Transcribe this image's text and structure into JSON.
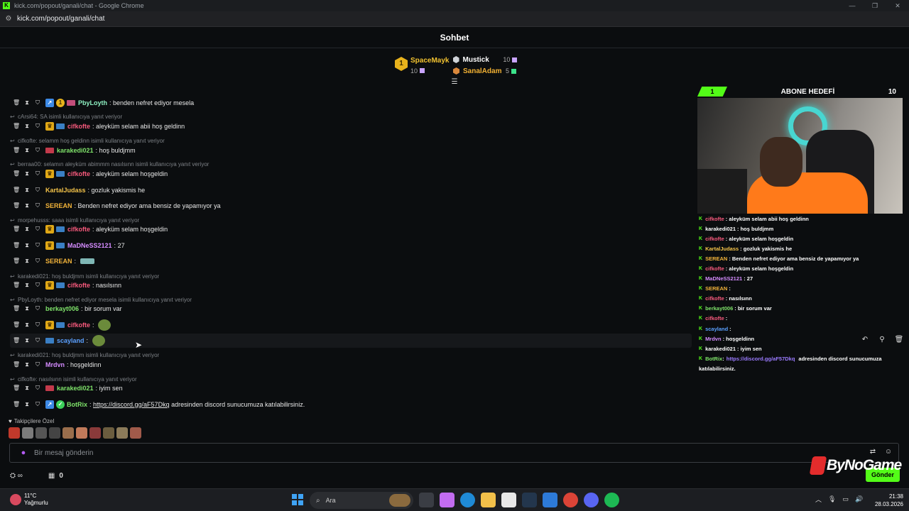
{
  "window": {
    "title": "kick.com/popout/ganali/chat - Google Chrome",
    "url": "kick.com/popout/ganali/chat"
  },
  "header": {
    "title": "Sohbet"
  },
  "leaderboard": {
    "first": {
      "rank": "1",
      "name": "SpaceMayk",
      "count": "10"
    },
    "others": [
      {
        "name": "Mustick",
        "count": "10"
      },
      {
        "name": "SanalAdam",
        "count": "5"
      }
    ]
  },
  "messages": [
    {
      "reply": "",
      "user": "PbyLoyth",
      "text": "benden nefret ediyor mesela",
      "user_color": "#8ef1c2"
    },
    {
      "reply": "cArsi64: SA isimli kullanıcıya yanıt veriyor",
      "user": "cifkofte",
      "text": "aleyküm selam abii hoş geldinn",
      "user_color": "#f85a7d"
    },
    {
      "reply": "cifkofte: selamm hoş geldinn isimli kullanıcıya yanıt veriyor",
      "user": "karakedi021",
      "text": "hoş buldjmm",
      "user_color": "#7fe36a"
    },
    {
      "reply": "berraa00: selamın aleyküm abimmm nasılsınn isimli kullanıcıya yanıt veriyor",
      "user": "cifkofte",
      "text": "aleyküm selam hoşgeldin",
      "user_color": "#f85a7d"
    },
    {
      "reply": "",
      "user": "KartalJudass",
      "text": "gozluk yakismis he",
      "user_color": "#f6c54a"
    },
    {
      "reply": "",
      "user": "SEREAN",
      "text": "Benden nefret ediyor ama bensiz de yapamıyor ya",
      "user_color": "#f3b43a"
    },
    {
      "reply": "morpehusss: saaa isimli kullanıcıya yanıt veriyor",
      "user": "cifkofte",
      "text": "aleyküm selam hoşgeldin",
      "user_color": "#f85a7d"
    },
    {
      "reply": "",
      "user": "MaDNeSS2121",
      "text": "27",
      "user_color": "#d58cff"
    },
    {
      "reply": "",
      "user": "SEREAN",
      "text": "",
      "user_color": "#f3b43a"
    },
    {
      "reply": "karakedi021: hoş buldjmm isimli kullanıcıya yanıt veriyor",
      "user": "cifkofte",
      "text": "nasılsınn",
      "user_color": "#f85a7d"
    },
    {
      "reply": "PbyLoyth: benden nefret ediyor mesela isimli kullanıcıya yanıt veriyor",
      "user": "berkayt006",
      "text": "bir sorum var",
      "user_color": "#7fe36a"
    },
    {
      "reply": "",
      "user": "cifkofte",
      "text": "",
      "user_color": "#f85a7d"
    },
    {
      "reply": "",
      "user": "scayland",
      "text": "",
      "user_color": "#5aa0ff"
    },
    {
      "reply": "karakedi021: hoş buldjmm isimli kullanıcıya yanıt veriyor",
      "user": "Mrdvn",
      "text": "hoşgeldinn",
      "user_color": "#d58cff"
    },
    {
      "reply": "cifkofte: nasılsınn isimli kullanıcıya yanıt veriyor",
      "user": "karakedi021",
      "text": "iyim sen",
      "user_color": "#7fe36a"
    },
    {
      "reply": "",
      "user": "BotRix",
      "text_link": "https://discord.gg/aF57Dkq",
      "text": "adresinden discord sunucumuza katılabilirsiniz.",
      "user_color": "#7fe36a"
    }
  ],
  "emote_bar": {
    "label": "Takipçilere Özel"
  },
  "input": {
    "placeholder": "Bir mesaj gönderin"
  },
  "bottom": {
    "count": "0",
    "send_label": "Gönder"
  },
  "overlay": {
    "goal_start": "1",
    "goal_title": "ABONE HEDEFİ",
    "goal_end": "10",
    "chat": [
      {
        "user": "cifkofte",
        "text": ": aleyküm selam abii hoş geldinn",
        "color": "#f85a7d"
      },
      {
        "user": "karakedi021",
        "text": ": hoş buldjmm",
        "color": "#ffffff"
      },
      {
        "user": "cifkofte",
        "text": ": aleyküm selam hoşgeldin",
        "color": "#f85a7d"
      },
      {
        "user": "KartalJudass",
        "text": ": gozluk yakismis he",
        "color": "#f6c54a"
      },
      {
        "user": "SEREAN",
        "text": ": Benden nefret ediyor ama bensiz de yapamıyor ya",
        "color": "#f3b43a"
      },
      {
        "user": "cifkofte",
        "text": ": aleyküm selam hoşgeldin",
        "color": "#f85a7d"
      },
      {
        "user": "MaDNeSS2121",
        "text": ": 27",
        "color": "#d58cff"
      },
      {
        "user": "SEREAN",
        "text": ":",
        "color": "#f3b43a"
      },
      {
        "user": "cifkofte",
        "text": ": nasılsınn",
        "color": "#f85a7d"
      },
      {
        "user": "berkayt006",
        "text": ": bir sorum var",
        "color": "#7fe36a"
      },
      {
        "user": "cifkofte",
        "text": ":",
        "color": "#f85a7d"
      },
      {
        "user": "scayland",
        "text": ":",
        "color": "#5aa0ff"
      },
      {
        "user": "Mrdvn",
        "text": ": hoşgeldinn",
        "color": "#d58cff"
      },
      {
        "user": "karakedi021",
        "text": ": iyim sen",
        "color": "#ffffff"
      },
      {
        "user": "BotRix",
        "link": "https://discord.gg/aF57Dkq",
        "text": "adresinden discord sunucumuza",
        "text2": "katılabilirsiniz.",
        "color": "#7fe36a"
      }
    ]
  },
  "branding": {
    "text": "ByNoGame"
  },
  "taskbar": {
    "weather_temp": "11°C",
    "weather_desc": "Yağmurlu",
    "search_label": "Ara",
    "time": "21:38",
    "date": "28.03.2026"
  },
  "colors": {
    "accent": "#53fc18",
    "background": "#0b0d0f"
  }
}
